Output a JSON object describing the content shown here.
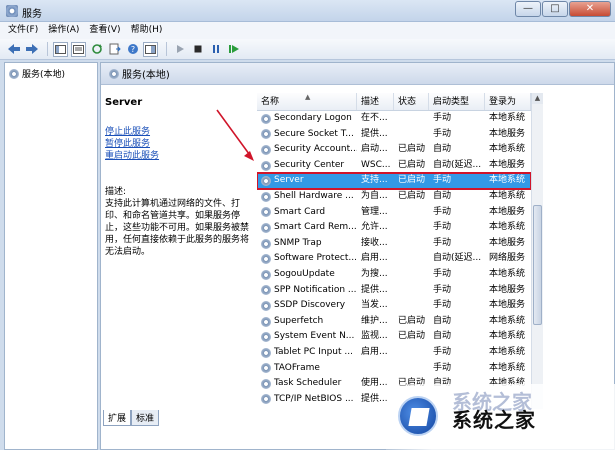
{
  "window": {
    "title": "服务",
    "minimize": "—",
    "maximize": "□",
    "close": "✕"
  },
  "menu": [
    "文件(F)",
    "操作(A)",
    "查看(V)",
    "帮助(H)"
  ],
  "tree": {
    "item": "服务(本地)"
  },
  "panel": {
    "header": "服务(本地)",
    "service_name": "Server",
    "actions": [
      "停止此服务",
      "暂停此服务",
      "重启动此服务"
    ],
    "desc_label": "描述:",
    "desc_text": "支持此计算机通过网络的文件、打印、和命名管道共享。如果服务停止，这些功能不可用。如果服务被禁用，任何直接依赖于此服务的服务将无法启动。"
  },
  "table": {
    "columns": [
      "名称",
      "描述",
      "状态",
      "启动类型",
      "登录为"
    ],
    "rows": [
      [
        "Secondary Logon",
        "在不...",
        "",
        "手动",
        "本地系统"
      ],
      [
        "Secure Socket T...",
        "提供...",
        "",
        "手动",
        "本地服务"
      ],
      [
        "Security Account...",
        "启动...",
        "已启动",
        "自动",
        "本地系统"
      ],
      [
        "Security Center",
        "WSC...",
        "已启动",
        "自动(延迟...",
        "本地服务"
      ],
      [
        "Server",
        "支持...",
        "已启动",
        "手动",
        "本地系统"
      ],
      [
        "Shell Hardware ...",
        "为自...",
        "已启动",
        "自动",
        "本地系统"
      ],
      [
        "Smart Card",
        "管理...",
        "",
        "手动",
        "本地服务"
      ],
      [
        "Smart Card Rem...",
        "允许...",
        "",
        "手动",
        "本地系统"
      ],
      [
        "SNMP Trap",
        "接收...",
        "",
        "手动",
        "本地服务"
      ],
      [
        "Software Protect...",
        "启用...",
        "",
        "自动(延迟...",
        "网络服务"
      ],
      [
        "SogouUpdate",
        "为搜...",
        "",
        "手动",
        "本地系统"
      ],
      [
        "SPP Notification ...",
        "提供...",
        "",
        "手动",
        "本地服务"
      ],
      [
        "SSDP Discovery",
        "当发...",
        "",
        "手动",
        "本地服务"
      ],
      [
        "Superfetch",
        "维护...",
        "已启动",
        "自动",
        "本地系统"
      ],
      [
        "System Event N...",
        "监视...",
        "已启动",
        "自动",
        "本地系统"
      ],
      [
        "Tablet PC Input ...",
        "启用...",
        "",
        "手动",
        "本地系统"
      ],
      [
        "TAOFrame",
        "",
        "",
        "手动",
        "本地系统"
      ],
      [
        "Task Scheduler",
        "使用...",
        "已启动",
        "自动",
        "本地系统"
      ],
      [
        "TCP/IP NetBIOS ...",
        "提供...",
        "",
        "",
        ""
      ]
    ],
    "selected_index": 4
  },
  "tabs": [
    "扩展",
    "标准"
  ],
  "watermark": {
    "text": "系统之家",
    "faded": "系统之家"
  },
  "colors": {
    "selection": "#3399e6",
    "highlight_box": "#d0152a",
    "link": "#1a4fb8"
  }
}
